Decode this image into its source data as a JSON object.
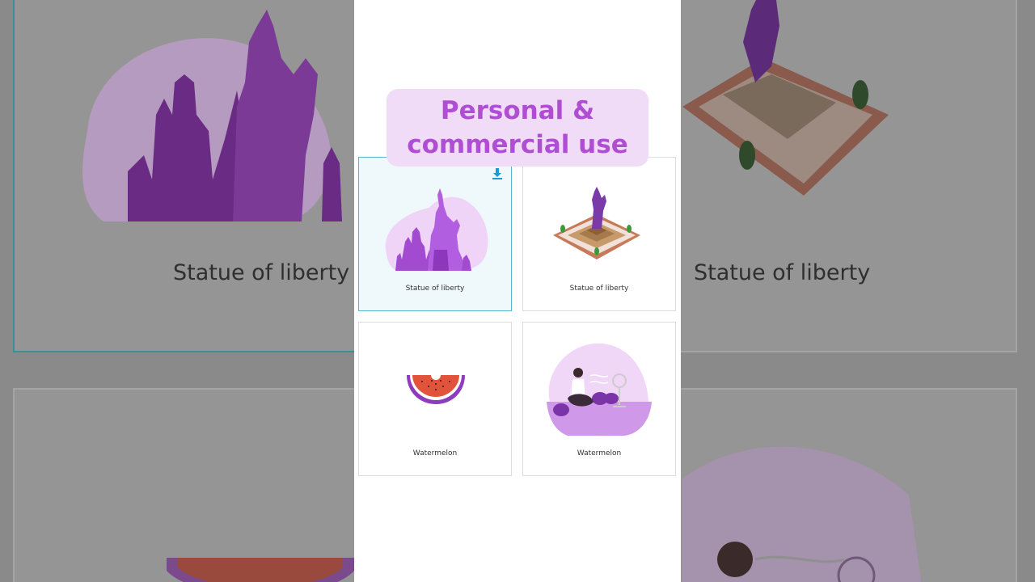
{
  "banner": {
    "line1": "Personal &",
    "line2": "commercial use"
  },
  "cards": [
    {
      "label": "Statue of liberty",
      "selected": true
    },
    {
      "label": "Statue of liberty",
      "selected": false
    },
    {
      "label": "Watermelon",
      "selected": false
    },
    {
      "label": "Watermelon",
      "selected": false
    }
  ],
  "background": {
    "left_label": "Statue of liberty",
    "right_label": "Statue of liberty"
  },
  "colors": {
    "accent": "#b04ed3",
    "banner_bg": "#f1dcf8",
    "selected_border": "#59b6cf",
    "download_icon": "#1e9ad6"
  },
  "icons": [
    "download-icon"
  ]
}
